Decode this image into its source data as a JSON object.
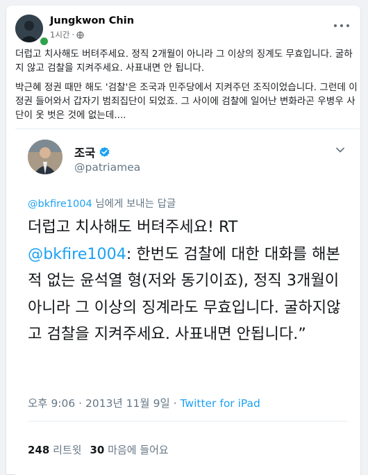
{
  "post": {
    "author": "Jungkwon Chin",
    "time": "1시간",
    "text_p1": "더럽고 치사해도 버텨주세요. 정직 2개월이 아니라 그 이상의 징계도 무효입니다. 굴하지 않고 검찰을 지켜주세요. 사표내면 안 됩니다.",
    "text_p2": "박근혜 정권 때만 해도 '검찰'은 조국과 민주당에서 지켜주던 조직이었습니다. 그런데 이 정권 들어와서 갑자기 범죄집단이 되었죠. 그 사이에 검찰에 일어난 변화라곤 우병우 사단이 옷 벗은 것에 없는데...."
  },
  "tweet": {
    "name": "조국",
    "handle": "@patriamea",
    "reply_to_handle": "@bkfire1004",
    "reply_suffix": " 님에게 보내는 답글",
    "body_start": "더럽고 치사해도 버텨주세요! RT\n",
    "body_mention": "@bkfire1004",
    "body_rest": ": 한번도 검찰에 대한 대화를 해본적 없는 윤석열 형(저와 동기이죠), 정직 3개월이 아니라 그 이상의 징계라도 무효입니다. 굴하지않고 검찰을 지켜주세요. 사표내면 안됩니다.”",
    "timestamp": "오후 9:06 · 2013년 11월 9일 · ",
    "source": "Twitter for iPad",
    "retweets_count": "248",
    "retweets_label": "리트윗",
    "likes_count": "30",
    "likes_label": "마음에 들어요"
  },
  "colors": {
    "twitter_blue": "#1da1f2",
    "facebook_bg": "#f0f2f5",
    "muted": "#657786"
  }
}
